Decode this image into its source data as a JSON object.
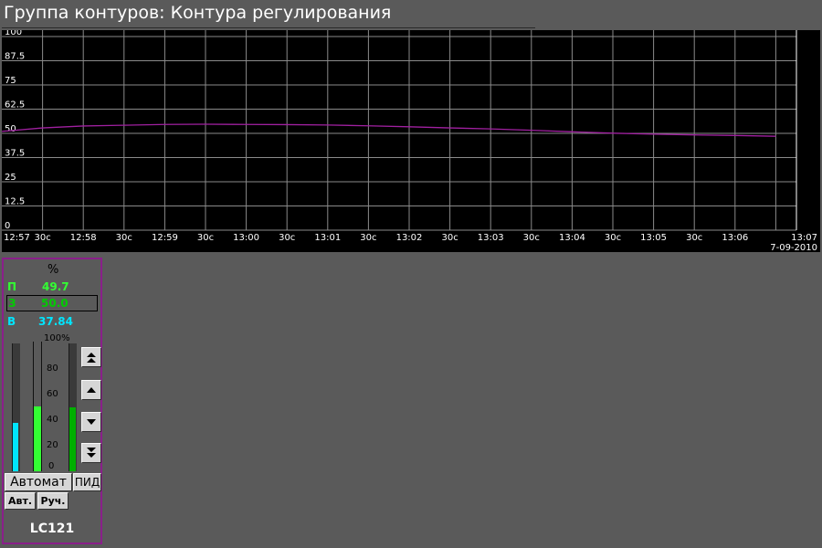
{
  "window": {
    "title": "Группа контуров: Контура регулирования"
  },
  "trend": {
    "y_ticks": [
      "100",
      "87.5",
      "75",
      "62.5",
      "50",
      "37.5",
      "25",
      "12.5",
      "0"
    ],
    "x_ticks": [
      "12:57",
      "30с",
      "12:58",
      "30с",
      "12:59",
      "30с",
      "13:00",
      "30с",
      "13:01",
      "30с",
      "13:02",
      "30с",
      "13:03",
      "30с",
      "13:04",
      "30с",
      "13:05",
      "30с",
      "13:06",
      "13:07"
    ],
    "date": "7-09-2010",
    "line_color": "#a020a0"
  },
  "chart_data": {
    "type": "line",
    "ylim": [
      0,
      100
    ],
    "x": [
      "12:57:00",
      "12:57:30",
      "12:58:00",
      "12:58:30",
      "12:59:00",
      "12:59:30",
      "13:00:00",
      "13:00:30",
      "13:01:00",
      "13:01:30",
      "13:02:00",
      "13:02:30",
      "13:03:00",
      "13:03:30",
      "13:04:00",
      "13:04:30",
      "13:05:00",
      "13:05:30",
      "13:06:00",
      "13:06:30"
    ],
    "series": [
      {
        "values": [
          51.0,
          52.8,
          53.8,
          54.2,
          54.6,
          54.7,
          54.6,
          54.5,
          54.3,
          53.9,
          53.4,
          52.8,
          52.3,
          51.6,
          50.8,
          50.1,
          49.6,
          49.2,
          48.9,
          48.5
        ]
      }
    ],
    "grid": true
  },
  "loop": {
    "unit": "%",
    "p_label": "П",
    "p_value": "49.7",
    "z_label": "З",
    "z_value": "50.0",
    "v_label": "В",
    "v_value": "37.84",
    "scale": [
      "100%",
      "80",
      "60",
      "40",
      "20",
      "0"
    ],
    "bar_output": 37.84,
    "bar_pv": 49.7,
    "bar_sp": 50.0,
    "mode": "Автомат",
    "pid": "ПИД",
    "auto": "Авт.",
    "manual": "Руч.",
    "tag": "LC121",
    "colors": {
      "p": "#33ff33",
      "z": "#00cc00",
      "v": "#00e5ff",
      "frame": "#8a1f8a"
    }
  }
}
